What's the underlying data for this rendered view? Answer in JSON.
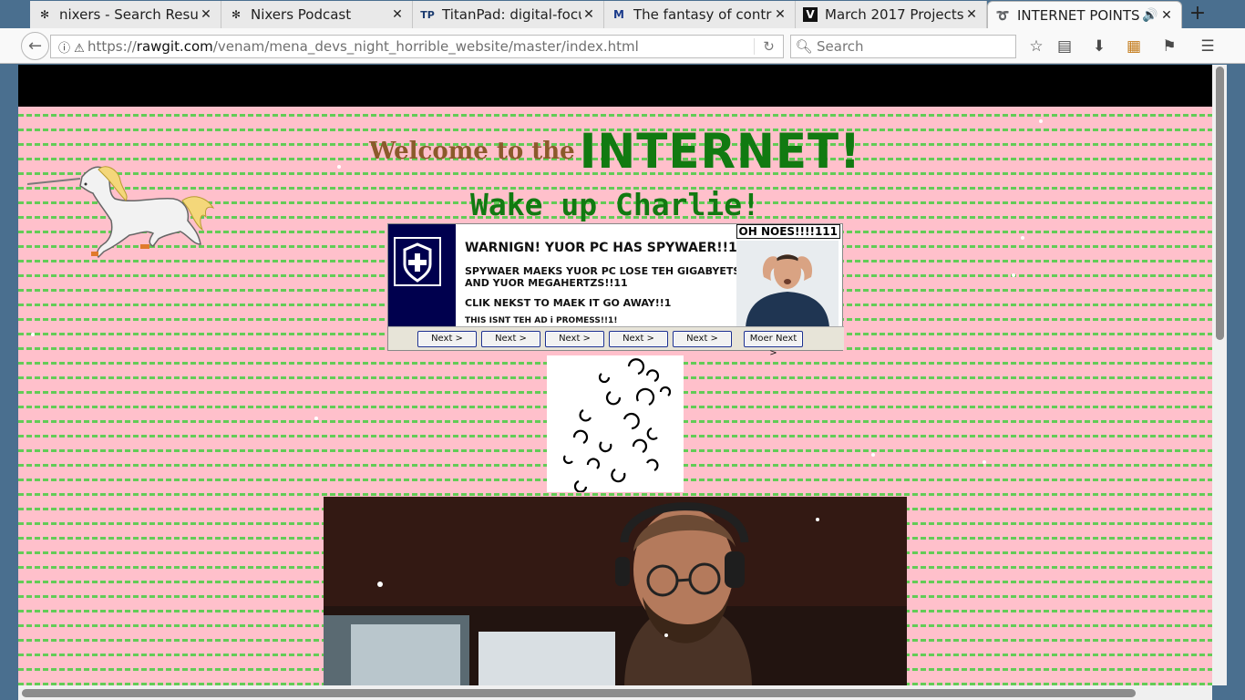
{
  "browser": {
    "tabs": [
      {
        "title": "nixers - Search Resu…",
        "icon": "asterisk-icon",
        "active": false
      },
      {
        "title": "Nixers Podcast",
        "icon": "asterisk-icon",
        "active": false
      },
      {
        "title": "TitanPad: digital-focu…",
        "icon": "tp-icon",
        "active": false
      },
      {
        "title": "The fantasy of contr…",
        "icon": "m-icon",
        "active": false
      },
      {
        "title": "March 2017 Projects",
        "icon": "v-icon",
        "active": false
      },
      {
        "title": "INTERNET POINTS",
        "icon": "swirl-icon",
        "active": true
      }
    ],
    "url_prefix": "https://",
    "url_host": "rawgit.com",
    "url_path": "/venam/mena_devs_night_horrible_website/master/index.html",
    "search_placeholder": "Search"
  },
  "page": {
    "welcome_small": "Welcome to the",
    "welcome_big": "INTERNET!",
    "wakeup": "Wake up Charlie!",
    "ad": {
      "bubble": "OH NOES!!!!111",
      "line1": "WARNIGN!   YUOR PC HAS SPYWAER!!1",
      "line2a": "SPYWAER MAEKS YUOR PC LOSE TEH GIGABYETS",
      "line2b": "AND YUOR MEGAHERTZS!!11",
      "line3": "CLIK NEKST TO MAEK IT GO AWAY!!1",
      "line4": "THIS  ISNT  TEH  AD  i  PROMESS!!1!",
      "buttons": [
        "Next >",
        "Next >",
        "Next >",
        "Next >",
        "Next >",
        "Moer Next >"
      ]
    }
  },
  "colors": {
    "page_bg": "#ffc0cb",
    "stripe": "#5acd50",
    "heading_green": "#117a11",
    "welcome_brown": "#8b5a2b"
  }
}
